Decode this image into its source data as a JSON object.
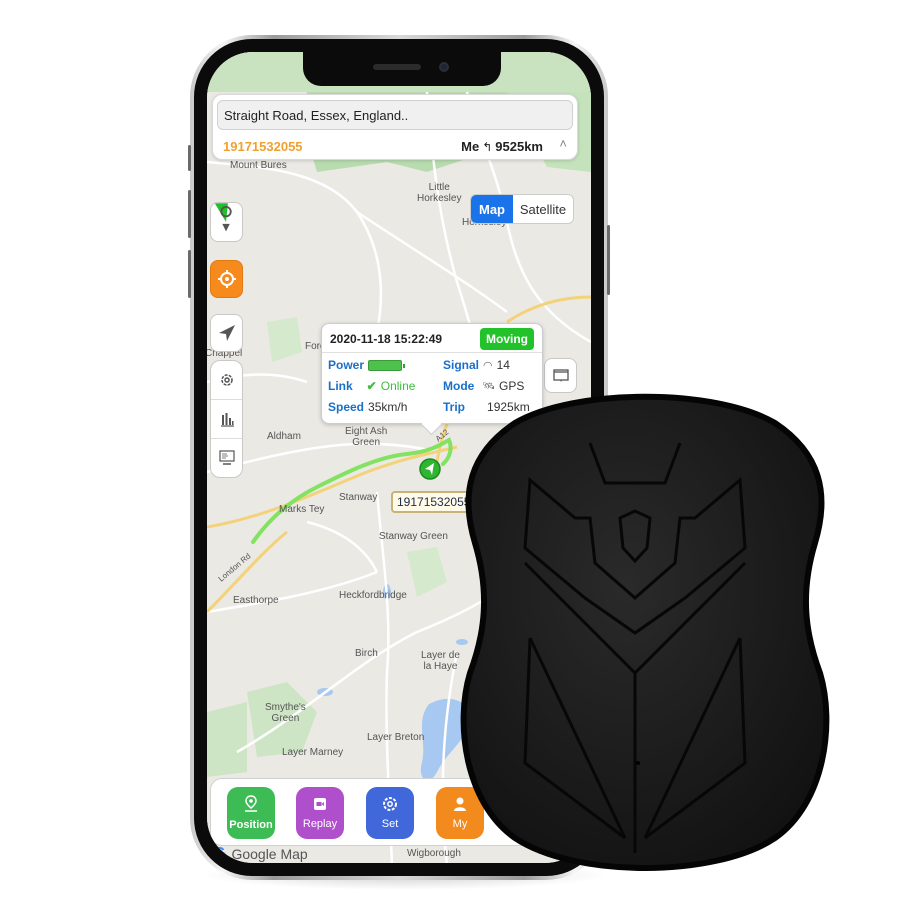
{
  "header": {
    "address": "Straight Road, Essex, England..",
    "device_id": "19171532055",
    "me_label": "Me",
    "distance": "9525km",
    "collapse_icon": "double-chevron-up-icon"
  },
  "map_toggle": {
    "map": "Map",
    "satellite": "Satellite",
    "selected": "Map"
  },
  "left_controls": [
    {
      "icon": "location-direction-icon"
    },
    {
      "icon": "locate-target-icon"
    },
    {
      "icon": "navigate-arrow-icon"
    },
    {
      "icon": "gear-icon"
    },
    {
      "icon": "bar-chart-icon"
    },
    {
      "icon": "monitor-report-icon"
    }
  ],
  "right_control": {
    "icon": "message-screen-icon"
  },
  "popup": {
    "timestamp": "2020-11-18 15:22:49",
    "status": "Moving",
    "power_label": "Power",
    "signal_label": "Signal",
    "signal_value": "14",
    "link_label": "Link",
    "link_value": "Online",
    "mode_label": "Mode",
    "mode_value": "GPS",
    "speed_label": "Speed",
    "speed_value": "35km/h",
    "trip_label": "Trip",
    "trip_value": "1925km"
  },
  "marker_label": "19171532055",
  "places": {
    "mount_bures": "Mount Bures",
    "little_horkesley": "Little\nHorkesley",
    "horkesley": "Horkesley",
    "fordham": "Fordham",
    "aldham": "Aldham",
    "eight_ash_green": "Eight Ash\nGreen",
    "stanway": "Stanway",
    "marks_tey": "Marks Tey",
    "stanway_green": "Stanway Green",
    "london_rd": "London Rd",
    "easthorpe": "Easthorpe",
    "heckfordbridge": "Heckfordbridge",
    "birch": "Birch",
    "layer_de_la_haye": "Layer de\nla Haye",
    "smythes_green": "Smythe's\nGreen",
    "layer_breton": "Layer Breton",
    "layer_marney": "Layer Marney",
    "great_wigborough": "Great\nWigborough",
    "a12": "A12",
    "chappel": "Chappel"
  },
  "bottom_nav": [
    {
      "label": "Position",
      "icon": "map-pin-icon",
      "color": "#3dbc55",
      "active": true
    },
    {
      "label": "Replay",
      "icon": "video-icon",
      "color": "#b04fcb"
    },
    {
      "label": "Set",
      "icon": "gear-icon",
      "color": "#4068da"
    },
    {
      "label": "My",
      "icon": "user-icon",
      "color": "#f28a1d"
    }
  ],
  "google_map_label": "Google Map",
  "colors": {
    "accent_blue": "#1a73e8",
    "status_green": "#22c22a",
    "device_id_orange": "#f0a030",
    "route_green": "#7de25a"
  }
}
